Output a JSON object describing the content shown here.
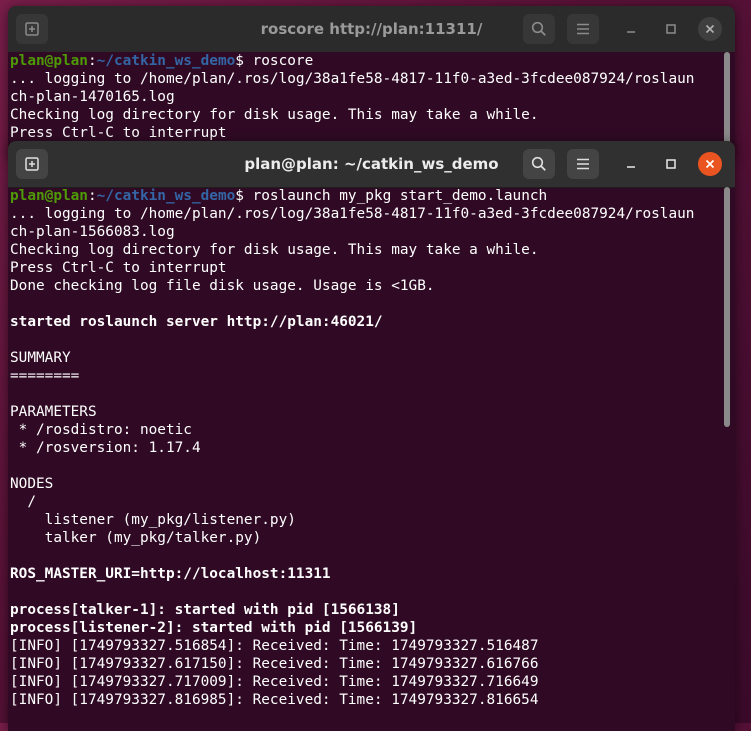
{
  "back_window": {
    "title": "roscore http://plan:11311/",
    "prompt": {
      "user": "plan@plan",
      "colon": ":",
      "path": "~/catkin_ws_demo",
      "dollar": "$ ",
      "command": "roscore"
    },
    "lines": [
      "... logging to /home/plan/.ros/log/38a1fe58-4817-11f0-a3ed-3fcdee087924/roslaun",
      "ch-plan-1470165.log",
      "Checking log directory for disk usage. This may take a while.",
      "Press Ctrl-C to interrupt"
    ]
  },
  "front_window": {
    "title": "plan@plan: ~/catkin_ws_demo",
    "prompt": {
      "user": "plan@plan",
      "colon": ":",
      "path": "~/catkin_ws_demo",
      "dollar": "$ ",
      "command": "roslaunch my_pkg start_demo.launch"
    },
    "lines": [
      {
        "text": "... logging to /home/plan/.ros/log/38a1fe58-4817-11f0-a3ed-3fcdee087924/roslaun",
        "bold": false
      },
      {
        "text": "ch-plan-1566083.log",
        "bold": false
      },
      {
        "text": "Checking log directory for disk usage. This may take a while.",
        "bold": false
      },
      {
        "text": "Press Ctrl-C to interrupt",
        "bold": false
      },
      {
        "text": "Done checking log file disk usage. Usage is <1GB.",
        "bold": false
      },
      {
        "text": "",
        "bold": false
      },
      {
        "text": "started roslaunch server http://plan:46021/",
        "bold": true
      },
      {
        "text": "",
        "bold": false
      },
      {
        "text": "SUMMARY",
        "bold": false
      },
      {
        "text": "========",
        "bold": false
      },
      {
        "text": "",
        "bold": false
      },
      {
        "text": "PARAMETERS",
        "bold": false
      },
      {
        "text": " * /rosdistro: noetic",
        "bold": false
      },
      {
        "text": " * /rosversion: 1.17.4",
        "bold": false
      },
      {
        "text": "",
        "bold": false
      },
      {
        "text": "NODES",
        "bold": false
      },
      {
        "text": "  /",
        "bold": false
      },
      {
        "text": "    listener (my_pkg/listener.py)",
        "bold": false
      },
      {
        "text": "    talker (my_pkg/talker.py)",
        "bold": false
      },
      {
        "text": "",
        "bold": false
      },
      {
        "text": "ROS_MASTER_URI=http://localhost:11311",
        "bold": true
      },
      {
        "text": "",
        "bold": false
      },
      {
        "text": "process[talker-1]: started with pid [1566138]",
        "bold": true
      },
      {
        "text": "process[listener-2]: started with pid [1566139]",
        "bold": true
      },
      {
        "text": "[INFO] [1749793327.516854]: Received: Time: 1749793327.516487",
        "bold": false
      },
      {
        "text": "[INFO] [1749793327.617150]: Received: Time: 1749793327.616766",
        "bold": false
      },
      {
        "text": "[INFO] [1749793327.717009]: Received: Time: 1749793327.716649",
        "bold": false
      },
      {
        "text": "[INFO] [1749793327.816985]: Received: Time: 1749793327.816654",
        "bold": false
      }
    ]
  },
  "icons": {
    "new_tab": "new-tab-icon",
    "search": "search-icon",
    "menu": "hamburger-menu-icon",
    "minimize": "minimize-icon",
    "maximize": "maximize-icon",
    "close": "close-icon"
  },
  "colors": {
    "terminal_bg": "#300a24",
    "prompt_user": "#4e9a06",
    "prompt_path": "#3465a4",
    "close_active": "#e95420"
  }
}
